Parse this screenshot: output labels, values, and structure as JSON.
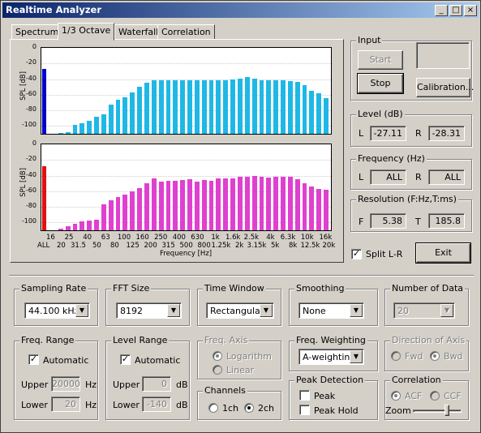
{
  "window": {
    "title": "Realtime Analyzer"
  },
  "tabs": [
    "Spectrum",
    "1/3 Octave",
    "Waterfall",
    "Correlation"
  ],
  "chart_data": [
    {
      "type": "bar",
      "ylabel": "SPL [dB]",
      "ylim": [
        -110,
        0
      ],
      "yticks": [
        "0",
        "-20",
        "-40",
        "-60",
        "-80",
        "-100"
      ],
      "color": "#1fb8e6",
      "all_color": "#0000c8",
      "all_value": -27,
      "values": [
        -110,
        -109,
        -108,
        -99,
        -96,
        -93,
        -88,
        -85,
        -73,
        -66,
        -63,
        -57,
        -50,
        -45,
        -42,
        -41,
        -41,
        -41,
        -41,
        -41,
        -41,
        -41,
        -41,
        -41,
        -41,
        -40,
        -39,
        -37,
        -39,
        -41,
        -42,
        -41,
        -42,
        -43,
        -44,
        -48,
        -55,
        -58,
        -64
      ]
    },
    {
      "type": "bar",
      "ylabel": "SPL [dB]",
      "ylim": [
        -110,
        0
      ],
      "yticks": [
        "0",
        "-20",
        "-40",
        "-60",
        "-80",
        "-100"
      ],
      "color": "#e040d0",
      "all_color": "#e01010",
      "all_value": -28,
      "values": [
        -110,
        -108,
        -105,
        -102,
        -99,
        -98,
        -96,
        -77,
        -72,
        -67,
        -64,
        -60,
        -56,
        -50,
        -44,
        -48,
        -47,
        -47,
        -46,
        -45,
        -48,
        -46,
        -47,
        -44,
        -44,
        -44,
        -42,
        -41,
        -40,
        -41,
        -43,
        -41,
        -41,
        -42,
        -45,
        -50,
        -54,
        -57,
        -58
      ]
    }
  ],
  "freq_axis": {
    "label": "Frequency [Hz]",
    "row1": [
      "16",
      "25",
      "40",
      "63",
      "100",
      "160",
      "250",
      "400",
      "630",
      "1k",
      "1.6k",
      "2.5k",
      "4k",
      "6.3k",
      "10k",
      "16k"
    ],
    "row2": [
      "ALL",
      "20",
      "31.5",
      "50",
      "80",
      "125",
      "200",
      "315",
      "500",
      "800",
      "1.25k",
      "2k",
      "3.15k",
      "5k",
      "8k",
      "12.5k",
      "20k"
    ]
  },
  "input": {
    "label": "Input",
    "start": "Start",
    "stop": "Stop",
    "calibration": "Calibration..."
  },
  "level": {
    "label": "Level (dB)",
    "l": "L",
    "r": "R",
    "lval": "-27.11",
    "rval": "-28.31"
  },
  "frequency": {
    "label": "Frequency (Hz)",
    "l": "L",
    "r": "R",
    "lval": "ALL",
    "rval": "ALL"
  },
  "resolution": {
    "label": "Resolution (F:Hz,T:ms)",
    "f": "F",
    "t": "T",
    "fval": "5.38",
    "tval": "185.8"
  },
  "split": "Split L-R",
  "exit": "Exit",
  "sampling": {
    "label": "Sampling Rate",
    "value": "44.100 kHz"
  },
  "fft": {
    "label": "FFT Size",
    "value": "8192"
  },
  "timewin": {
    "label": "Time Window",
    "value": "Rectangular"
  },
  "smoothing": {
    "label": "Smoothing",
    "value": "None"
  },
  "numdata": {
    "label": "Number of Data",
    "value": "20"
  },
  "freqrange": {
    "label": "Freq. Range",
    "auto": "Automatic",
    "upper": "Upper",
    "lower": "Lower",
    "upperval": "20000",
    "lowerval": "20",
    "unit": "Hz"
  },
  "levelrange": {
    "label": "Level Range",
    "auto": "Automatic",
    "upper": "Upper",
    "lower": "Lower",
    "upperval": "0",
    "lowerval": "-140",
    "unit": "dB"
  },
  "freqaxis": {
    "label": "Freq. Axis",
    "log": "Logarithm",
    "lin": "Linear"
  },
  "channels": {
    "label": "Channels",
    "ch1": "1ch",
    "ch2": "2ch"
  },
  "weighting": {
    "label": "Freq. Weighting",
    "value": "A-weighting"
  },
  "peak": {
    "label": "Peak Detection",
    "peak": "Peak",
    "hold": "Peak Hold"
  },
  "direction": {
    "label": "Direction of Axis",
    "fwd": "Fwd",
    "bwd": "Bwd"
  },
  "correlation": {
    "label": "Correlation",
    "acf": "ACF",
    "ccf": "CCF",
    "zoom": "Zoom",
    "zoom_level": 0.72
  }
}
